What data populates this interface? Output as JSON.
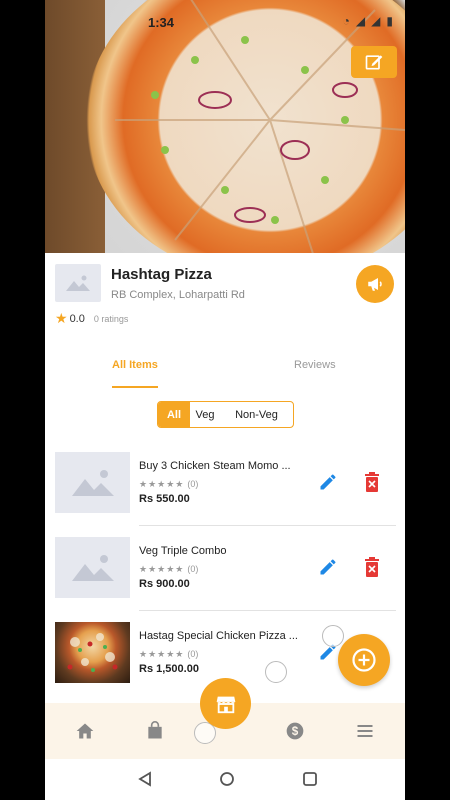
{
  "status_bar": {
    "time": "1:34"
  },
  "store": {
    "name": "Hashtag Pizza",
    "address": "RB Complex, Loharpatti Rd",
    "rating": "0.0",
    "ratings_count": "0 ratings"
  },
  "tabs": [
    {
      "label": "All Items",
      "active": true
    },
    {
      "label": "Reviews",
      "active": false
    }
  ],
  "filters": [
    {
      "label": "All",
      "active": true
    },
    {
      "label": "Veg",
      "active": false
    },
    {
      "label": "Non-Veg",
      "active": false
    }
  ],
  "items": [
    {
      "name": "Buy 3 Chicken Steam Momo ...",
      "stars": "★★★★★",
      "count": "(0)",
      "price": "Rs 550.00",
      "has_image": false
    },
    {
      "name": "Veg Triple Combo",
      "stars": "★★★★★",
      "count": "(0)",
      "price": "Rs 900.00",
      "has_image": false
    },
    {
      "name": "Hastag Special Chicken Pizza ...",
      "stars": "★★★★★",
      "count": "(0)",
      "price": "Rs 1,500.00",
      "has_image": true
    }
  ],
  "colors": {
    "accent": "#f5a623",
    "edit_blue": "#1e88e5",
    "delete_red": "#e53935"
  },
  "icons": {
    "edit_cover": "edit-square-icon",
    "promo": "megaphone-icon",
    "add": "plus-circle-icon",
    "store": "storefront-icon",
    "nav": [
      "home-icon",
      "bag-icon",
      "dollar-icon",
      "menu-icon"
    ]
  }
}
